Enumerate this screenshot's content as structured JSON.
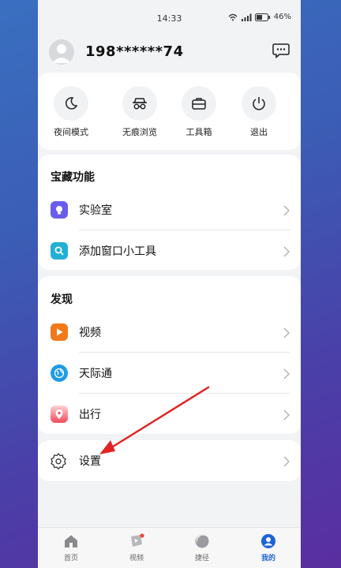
{
  "status": {
    "time": "14:33",
    "battery": "46%"
  },
  "profile": {
    "username": "198******74"
  },
  "quick_actions": [
    {
      "label": "夜间模式",
      "icon": "moon-icon"
    },
    {
      "label": "无痕浏览",
      "icon": "incognito-icon"
    },
    {
      "label": "工具箱",
      "icon": "toolbox-icon"
    },
    {
      "label": "退出",
      "icon": "power-icon"
    }
  ],
  "treasure": {
    "title": "宝藏功能",
    "items": [
      {
        "label": "实验室",
        "icon": "lab-bulb-icon",
        "color": "#6b5cf0"
      },
      {
        "label": "添加窗口小工具",
        "icon": "widget-search-icon",
        "color": "#22b0d6"
      }
    ]
  },
  "discover": {
    "title": "发现",
    "items": [
      {
        "label": "视频",
        "icon": "video-play-icon",
        "color": "#f07a1a"
      },
      {
        "label": "天际通",
        "icon": "globe-icon",
        "color": "#1f9be8"
      },
      {
        "label": "出行",
        "icon": "travel-pin-icon",
        "color": "#f24a5a"
      }
    ]
  },
  "settings": {
    "label": "设置"
  },
  "tabs": [
    {
      "label": "首页",
      "icon": "home-icon"
    },
    {
      "label": "视频",
      "icon": "video-tab-icon"
    },
    {
      "label": "捷径",
      "icon": "shortcut-icon"
    },
    {
      "label": "我的",
      "icon": "profile-icon"
    }
  ],
  "colors": {
    "accent": "#1e63d6",
    "annotation_arrow": "#e02424"
  }
}
